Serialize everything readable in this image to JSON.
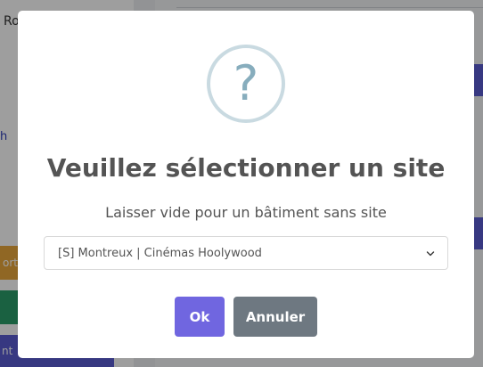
{
  "background": {
    "user_label": "Ro",
    "link_text": "h",
    "yellow_button_text": "ort",
    "blue_button_text": "nt"
  },
  "dialog": {
    "icon": "question-icon",
    "icon_glyph": "?",
    "title": "Veuillez sélectionner un site",
    "subtitle": "Laisser vide pour un bâtiment sans site",
    "select": {
      "value": "[S] Montreux | Cinémas Hoolywood"
    },
    "ok_label": "Ok",
    "cancel_label": "Annuler"
  },
  "colors": {
    "confirm": "#7066e0",
    "cancel": "#6e7881",
    "icon_ring": "#c9dae1",
    "icon_glyph": "#87adbd"
  }
}
